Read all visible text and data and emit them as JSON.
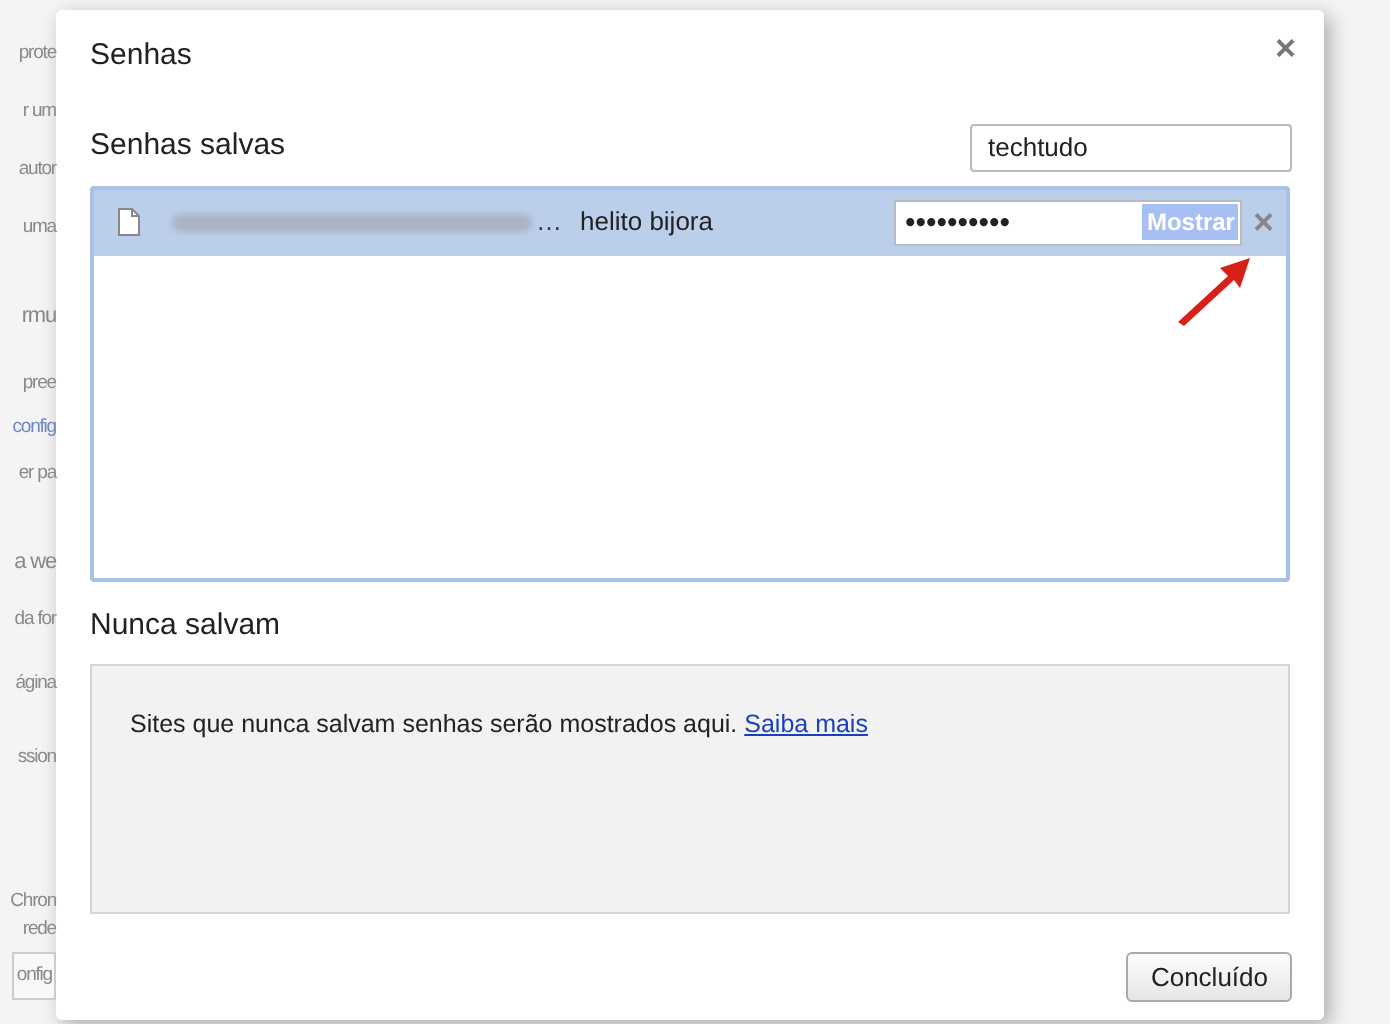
{
  "background_page": [
    {
      "kind": "text",
      "text": "prote"
    },
    {
      "kind": "text",
      "text": "r um"
    },
    {
      "kind": "text",
      "text": "autor"
    },
    {
      "kind": "text",
      "text": "uma"
    },
    {
      "kind": "heading",
      "text": "rmu"
    },
    {
      "kind": "text",
      "text": "pree"
    },
    {
      "kind": "link",
      "text": "config"
    },
    {
      "kind": "text",
      "text": "er pa"
    },
    {
      "kind": "heading",
      "text": "a we"
    },
    {
      "kind": "text",
      "text": "da for"
    },
    {
      "kind": "text",
      "text": "ágina"
    },
    {
      "kind": "text",
      "text": "ssion"
    },
    {
      "kind": "text",
      "text": "Chron"
    },
    {
      "kind": "text",
      "text": "rede"
    },
    {
      "kind": "button",
      "text": "onfig"
    }
  ],
  "dialog": {
    "title": "Senhas",
    "close": "×",
    "saved": {
      "heading": "Senhas salvas",
      "search": {
        "value": "techtudo"
      },
      "rows": [
        {
          "selected": true,
          "site_ellipsis": "…",
          "username": "helito bijora",
          "password": "••••••••••",
          "show_button": "Mostrar",
          "remove": "×"
        }
      ]
    },
    "never": {
      "heading": "Nunca salvam",
      "message": "Sites que nunca salvam senhas serão mostrados aqui.",
      "link": "Saiba mais"
    },
    "done_button": "Concluído"
  }
}
